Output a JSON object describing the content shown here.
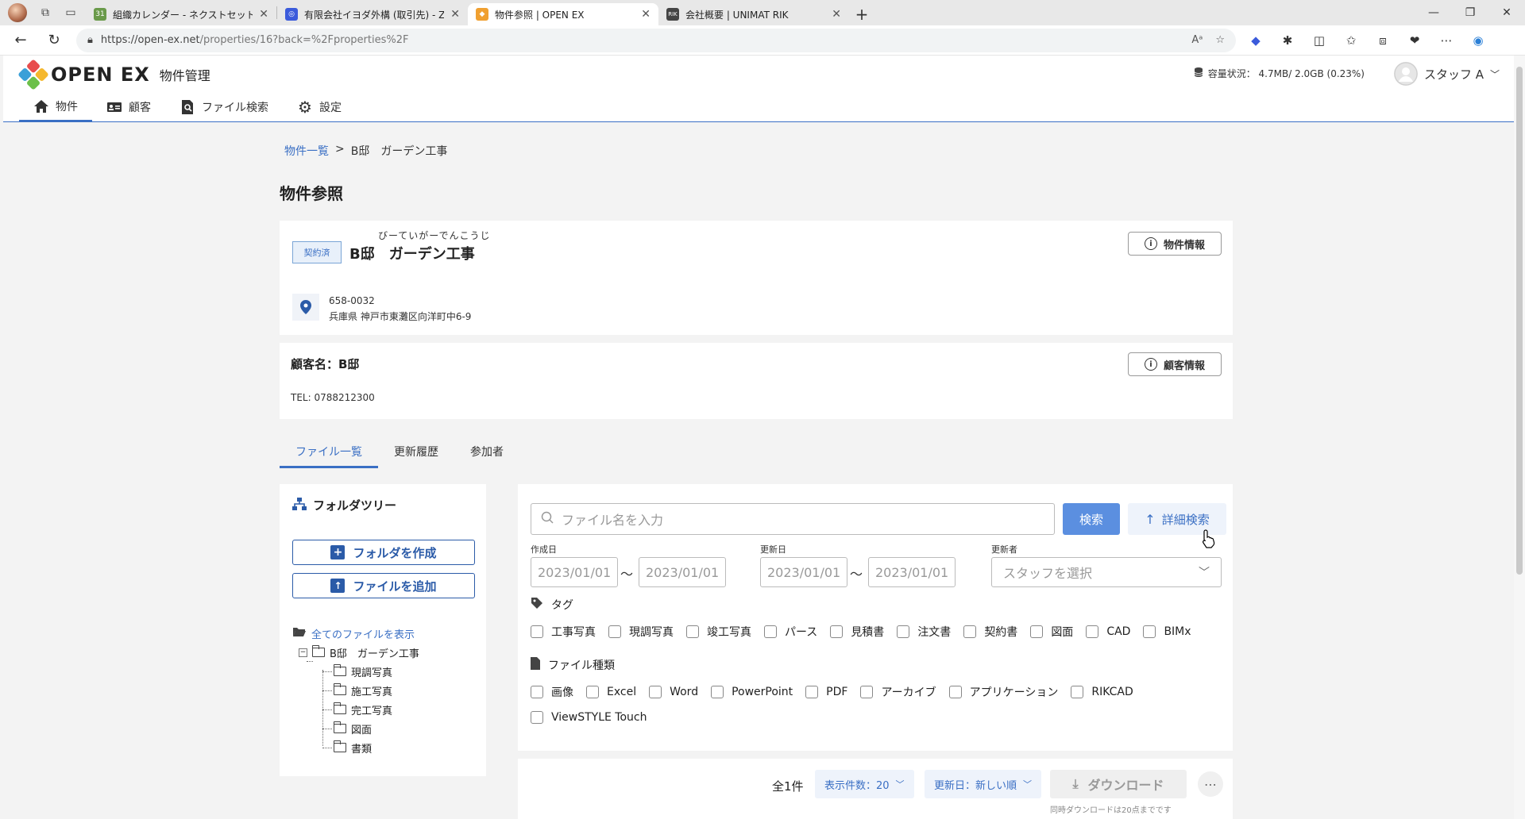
{
  "browser": {
    "tabs": [
      {
        "title": "組織カレンダー - ネクストセット",
        "fav_color": "#6a9a4a",
        "fav_text": "31"
      },
      {
        "title": "有限会社イヨダ外構 (取引先) - Zoh",
        "fav_color": "#3b5bdb",
        "fav_text": "◎"
      },
      {
        "title": "物件参照 | OPEN EX",
        "fav_color": "#f0a030",
        "fav_text": "◆"
      },
      {
        "title": "会社概要 | UNIMAT RIK",
        "fav_color": "#444444",
        "fav_text": "RIK"
      }
    ],
    "url_host": "https://open-ex.net",
    "url_path": "/properties/16?back=%2Fproperties%2F"
  },
  "header": {
    "logo": "OPEN EX",
    "logo_sub": "物件管理",
    "storage": "容量状況： 4.7MB/ 2.0GB (0.23%)",
    "user": "スタッフ A",
    "nav": [
      {
        "label": "物件",
        "icon": "home-icon"
      },
      {
        "label": "顧客",
        "icon": "id-card-icon"
      },
      {
        "label": "ファイル検索",
        "icon": "file-search-icon"
      },
      {
        "label": "設定",
        "icon": "gear-icon"
      }
    ]
  },
  "breadcrumb": {
    "root": "物件一覧",
    "sep": ">",
    "current": "B邸　ガーデン工事"
  },
  "page_title": "物件参照",
  "property": {
    "status": "契約済",
    "furigana": "びーていがーでんこうじ",
    "name": "B邸　ガーデン工事",
    "info_button": "物件情報",
    "postal": "658-0032",
    "address": "兵庫県 神戸市東灘区向洋町中6-9"
  },
  "customer": {
    "name": "顧客名：B邸",
    "tel": "TEL: 0788212300",
    "info_button": "顧客情報"
  },
  "tabs": [
    "ファイル一覧",
    "更新履歴",
    "参加者"
  ],
  "folder_tree": {
    "title": "フォルダツリー",
    "create_button": "フォルダを作成",
    "add_button": "ファイルを追加",
    "show_all": "全てのファイルを表示",
    "root": "B邸　ガーデン工事",
    "children": [
      "現調写真",
      "施工写真",
      "完工写真",
      "図面",
      "書類"
    ]
  },
  "search": {
    "placeholder": "ファイル名を入力",
    "search_button": "検索",
    "advanced_button": "詳細検索",
    "created_label": "作成日",
    "updated_label": "更新日",
    "updater_label": "更新者",
    "date_placeholder": "2023/01/01",
    "tilde": "〜",
    "staff_placeholder": "スタッフを選択",
    "tag_label": "タグ",
    "tags": [
      "工事写真",
      "現調写真",
      "竣工写真",
      "パース",
      "見積書",
      "注文書",
      "契約書",
      "図面",
      "CAD",
      "BIMx"
    ],
    "filetype_label": "ファイル種類",
    "filetypes": [
      "画像",
      "Excel",
      "Word",
      "PowerPoint",
      "PDF",
      "アーカイブ",
      "アプリケーション",
      "RIKCAD"
    ],
    "filetypes_row2": [
      "ViewSTYLE Touch"
    ]
  },
  "results": {
    "count": "全1件",
    "per_page": "表示件数：20",
    "sort": "更新日：新しい順",
    "download": "ダウンロード",
    "download_note": "同時ダウンロードは20点までです"
  }
}
